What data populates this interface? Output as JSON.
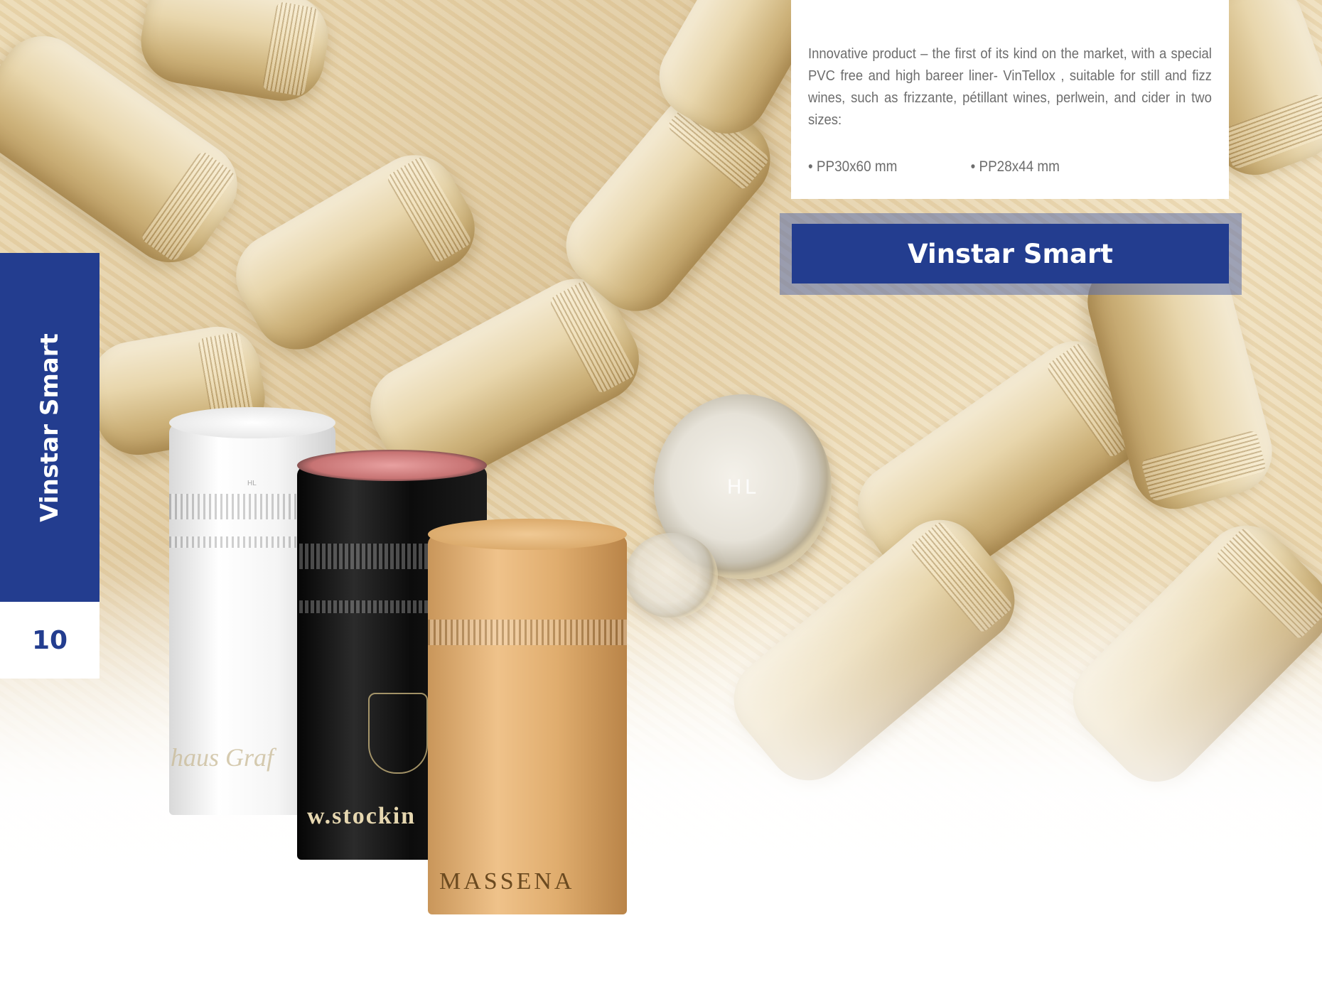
{
  "card": {
    "body": "Innovative product – the first of its kind on the market, with a special PVC free and high bareer liner- VinTellox , suitable for still and fizz wines, such as frizzante, pétillant wines, perlwein, and cider in two sizes:",
    "sizes": [
      "• PP30x60 mm",
      "• PP28x44 mm"
    ]
  },
  "title": "Vinstar Smart",
  "side_tab": "Vinstar Smart",
  "page_number": "10",
  "photo": {
    "disc_mark": "HL",
    "caps": {
      "white_print": "haus Graf",
      "white_mark": "HL",
      "black_print": "w.stockin",
      "gold_print": "MASSENA"
    }
  },
  "colors": {
    "brand_blue": "#233d8f",
    "body_text": "#6d6d6d"
  }
}
